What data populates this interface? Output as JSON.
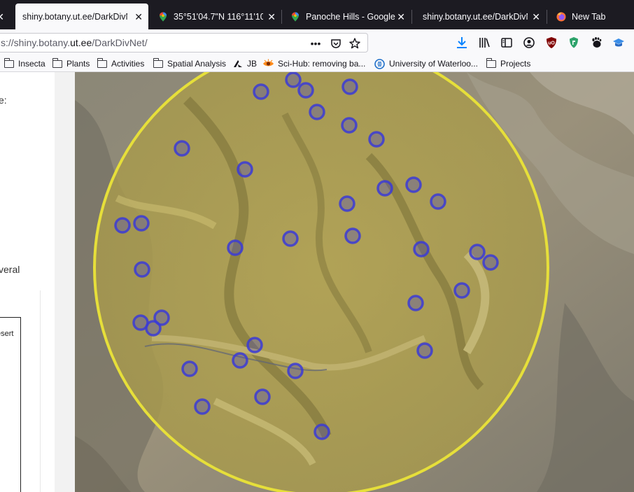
{
  "browser": {
    "tabs": [
      {
        "title": "shiny.botany.ut.ee/DarkDivN",
        "active": true,
        "icon": "none"
      },
      {
        "title": "35°51'04.7\"N 116°11'10.1",
        "active": false,
        "icon": "google-maps-pin-icon"
      },
      {
        "title": "Panoche Hills - Google M",
        "active": false,
        "icon": "google-maps-pin-icon"
      },
      {
        "title": "shiny.botany.ut.ee/DarkDivN",
        "active": false,
        "icon": "none"
      },
      {
        "title": "New Tab",
        "active": false,
        "icon": "firefox-icon"
      }
    ],
    "close_glyph": "✕",
    "url": {
      "prefix": "s://shiny.botany.",
      "domain": "ut.ee",
      "path": "/DarkDivNet/"
    },
    "bookmarks": [
      {
        "label": "Insecta",
        "icon": "folder-icon"
      },
      {
        "label": "Plants",
        "icon": "folder-icon"
      },
      {
        "label": "Activities",
        "icon": "folder-icon"
      },
      {
        "label": "Spatial Analysis",
        "icon": "folder-icon"
      },
      {
        "label": "JB",
        "icon": "jb-icon"
      },
      {
        "label": "Sci-Hub: removing ba...",
        "icon": "scihub-eye-icon"
      },
      {
        "label": "University of Waterloo...",
        "icon": "waterloo-icon"
      },
      {
        "label": "Projects",
        "icon": "folder-icon"
      }
    ]
  },
  "sidebar": {
    "fragment_1": "e:",
    "fragment_2": "veral",
    "plot_fragment": "esert"
  },
  "map": {
    "circle_color": "#e6df3a",
    "marker_color": "#3b3bd6",
    "marker_count": 39
  }
}
